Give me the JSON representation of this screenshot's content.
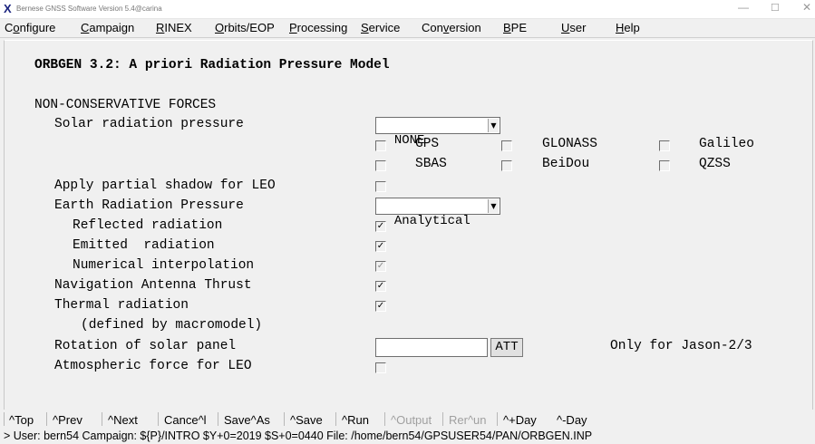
{
  "window": {
    "title": "Bernese GNSS Software Version 5.4@carina",
    "icon": "x-app-icon"
  },
  "menu": [
    {
      "pre": "C",
      "u": "o",
      "post": "nfigure"
    },
    {
      "pre": "",
      "u": "C",
      "post": "ampaign"
    },
    {
      "pre": "",
      "u": "R",
      "post": "INEX"
    },
    {
      "pre": "",
      "u": "O",
      "post": "rbits/EOP"
    },
    {
      "pre": "",
      "u": "P",
      "post": "rocessing"
    },
    {
      "pre": "",
      "u": "S",
      "post": "ervice"
    },
    {
      "pre": "Con",
      "u": "v",
      "post": "ersion"
    },
    {
      "pre": "",
      "u": "B",
      "post": "PE"
    },
    {
      "pre": "",
      "u": "U",
      "post": "ser"
    },
    {
      "pre": "",
      "u": "H",
      "post": "elp"
    }
  ],
  "panel": {
    "title": "ORBGEN 3.2: A priori Radiation Pressure Model",
    "section": "NON-CONSERVATIVE FORCES",
    "solar_label": "Solar radiation pressure",
    "solar_value": "NONE",
    "gnss": {
      "gps": "GPS",
      "glonass": "GLONASS",
      "galileo": "Galileo",
      "sbas": "SBAS",
      "beidou": "BeiDou",
      "qzss": "QZSS"
    },
    "partial_shadow_label": "Apply partial shadow for LEO",
    "earth_label": "Earth Radiation Pressure",
    "earth_value": "Analytical",
    "reflected_label": "Reflected radiation",
    "emitted_label": "Emitted  radiation",
    "numerical_label": "Numerical interpolation",
    "nav_antenna_label": "Navigation Antenna Thrust",
    "thermal_label": "Thermal radiation",
    "macromodel_label": "(defined by macromodel)",
    "rotation_label": "Rotation of solar panel",
    "rotation_value": "",
    "att_button": "ATT",
    "jason_note": "Only for Jason-2/3",
    "atmospheric_label": "Atmospheric force for LEO",
    "checked_mark": "✓"
  },
  "buttons": {
    "top": "^Top",
    "prev": "^Prev",
    "next": "^Next",
    "cancel": "Cance^l",
    "saveas": "Save^As",
    "save": "^Save",
    "run": "^Run",
    "output": "^Output",
    "rerun": "Rer^un",
    "plusday": "^+Day",
    "minusday": "^-Day"
  },
  "status": "> User: bern54  Campaign: ${P}/INTRO  $Y+0=2019  $S+0=0440  File: /home/bern54/GPSUSER54/PAN/ORBGEN.INP"
}
